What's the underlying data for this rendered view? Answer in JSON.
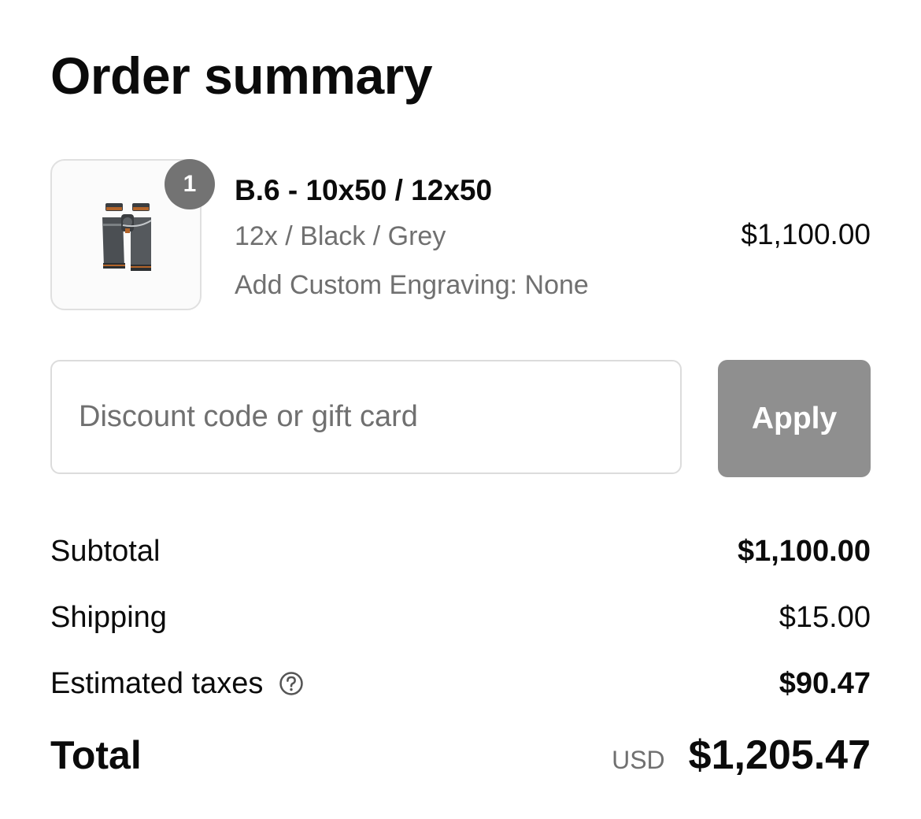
{
  "title": "Order summary",
  "line_item": {
    "quantity": "1",
    "name": "B.6 - 10x50 / 12x50",
    "variant": "12x / Black / Grey",
    "custom_option": "Add Custom Engraving: None",
    "price": "$1,100.00",
    "image_icon": "binoculars-icon"
  },
  "discount": {
    "placeholder": "Discount code or gift card",
    "value": "",
    "apply_label": "Apply"
  },
  "summary": {
    "subtotal_label": "Subtotal",
    "subtotal_value": "$1,100.00",
    "shipping_label": "Shipping",
    "shipping_value": "$15.00",
    "taxes_label": "Estimated taxes",
    "taxes_value": "$90.47",
    "total_label": "Total",
    "currency": "USD",
    "total_value": "$1,205.47"
  },
  "colors": {
    "badge": "#737373",
    "apply_button_disabled": "#8f8f8f",
    "muted_text": "#707070",
    "border": "#dcdcdc"
  }
}
